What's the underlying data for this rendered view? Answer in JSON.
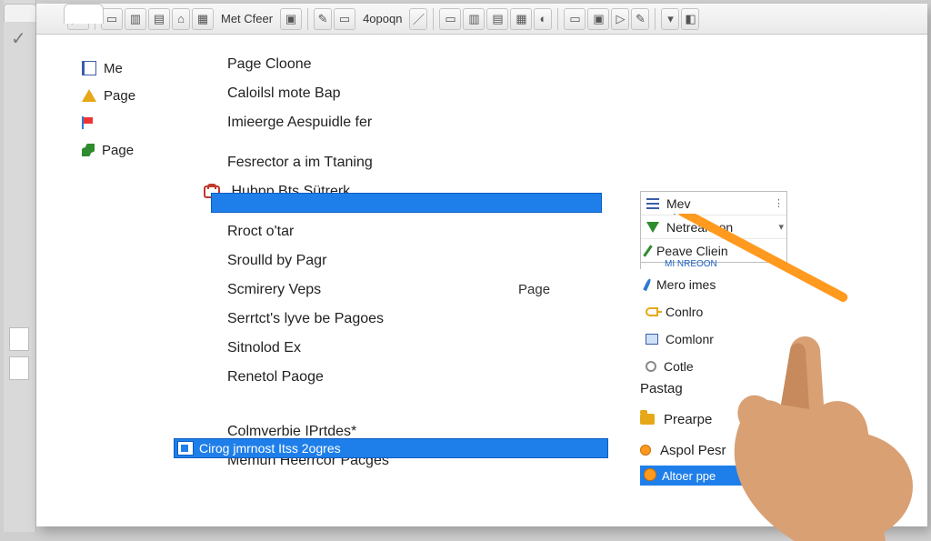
{
  "toolbar": {
    "label1": "Met Cfeer",
    "label2": "4opoqn"
  },
  "sidebar": {
    "items": [
      {
        "label": "Me"
      },
      {
        "label": "Page"
      },
      {
        "label": ""
      },
      {
        "label": "Page"
      }
    ]
  },
  "main": {
    "top": [
      "Page Cloone",
      "Caloilsl mote Bap",
      "Imieerge Aespuidle fer"
    ],
    "group2": [
      "Fesrector a im Ttaning",
      "Hubpp Bts Sütrerk"
    ],
    "group3": [
      "Rroct o'tar",
      "Sroulld by Pagr",
      "Scmirery Veps",
      "Serrtct's lyve be Pagoes",
      "Sitnolod Ex",
      "Renetol Paoge"
    ],
    "page_col_label": "Page",
    "highlight2": "Cirog jmrnost Itss 2ogres",
    "tail": [
      "Colmverbie IPrtdes*",
      "Memun Heerrcor Pacges"
    ]
  },
  "rmenu": {
    "boxed": [
      {
        "label": "Mev"
      },
      {
        "label": "Netreariaon"
      },
      {
        "label": "Peave   Cliein",
        "sub": "MI NREOON"
      }
    ],
    "list": [
      {
        "label": "Mero   imes"
      },
      {
        "label": "Conlro"
      },
      {
        "label": "Comlonr"
      },
      {
        "label": "Cotle"
      }
    ]
  },
  "rcol2": {
    "items": [
      {
        "label": "Pastag"
      },
      {
        "label": "Prearpe"
      },
      {
        "label": "Aspol  Pesr"
      }
    ],
    "highlight3": "Altoer ppe"
  },
  "colors": {
    "highlight": "#1f7fea",
    "accent_orange": "#ff9a1f"
  }
}
